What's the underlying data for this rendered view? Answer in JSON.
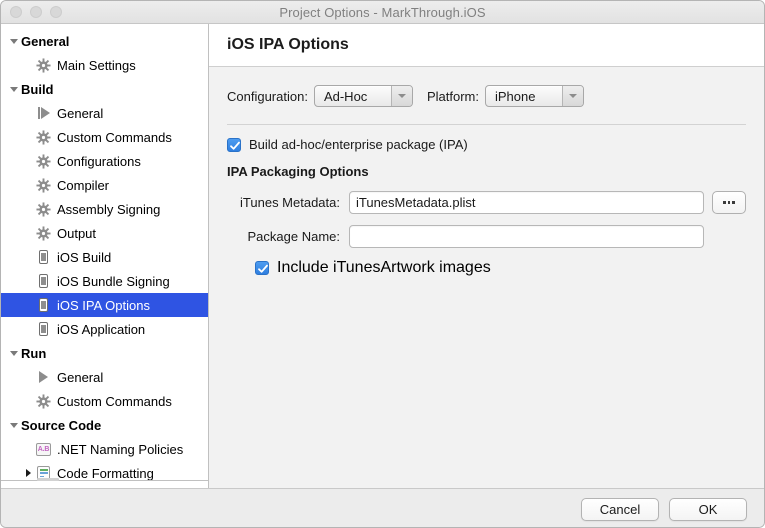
{
  "window": {
    "title": "Project Options - MarkThrough.iOS",
    "traffic_lights": [
      "close-button",
      "minimize-button",
      "zoom-button"
    ]
  },
  "sidebar": {
    "items": [
      {
        "label": "General",
        "level": 0,
        "type": "group",
        "disclosure": "down",
        "icon": "none",
        "selected": false
      },
      {
        "label": "Main Settings",
        "level": 1,
        "type": "item",
        "disclosure": "none",
        "icon": "gear-icon",
        "selected": false
      },
      {
        "label": "Build",
        "level": 0,
        "type": "group",
        "disclosure": "down",
        "icon": "none",
        "selected": false
      },
      {
        "label": "General",
        "level": 1,
        "type": "item",
        "disclosure": "none",
        "icon": "build-icon",
        "selected": false
      },
      {
        "label": "Custom Commands",
        "level": 1,
        "type": "item",
        "disclosure": "none",
        "icon": "gear-icon",
        "selected": false
      },
      {
        "label": "Configurations",
        "level": 1,
        "type": "item",
        "disclosure": "none",
        "icon": "gear-icon",
        "selected": false
      },
      {
        "label": "Compiler",
        "level": 1,
        "type": "item",
        "disclosure": "none",
        "icon": "gear-icon",
        "selected": false
      },
      {
        "label": "Assembly Signing",
        "level": 1,
        "type": "item",
        "disclosure": "none",
        "icon": "gear-icon",
        "selected": false
      },
      {
        "label": "Output",
        "level": 1,
        "type": "item",
        "disclosure": "none",
        "icon": "gear-icon",
        "selected": false
      },
      {
        "label": "iOS Build",
        "level": 1,
        "type": "item",
        "disclosure": "none",
        "icon": "device-icon",
        "selected": false
      },
      {
        "label": "iOS Bundle Signing",
        "level": 1,
        "type": "item",
        "disclosure": "none",
        "icon": "device-icon",
        "selected": false
      },
      {
        "label": "iOS IPA Options",
        "level": 1,
        "type": "item",
        "disclosure": "none",
        "icon": "device-icon",
        "selected": true
      },
      {
        "label": "iOS Application",
        "level": 1,
        "type": "item",
        "disclosure": "none",
        "icon": "device-icon",
        "selected": false
      },
      {
        "label": "Run",
        "level": 0,
        "type": "group",
        "disclosure": "down",
        "icon": "none",
        "selected": false
      },
      {
        "label": "General",
        "level": 1,
        "type": "item",
        "disclosure": "none",
        "icon": "play-icon",
        "selected": false
      },
      {
        "label": "Custom Commands",
        "level": 1,
        "type": "item",
        "disclosure": "none",
        "icon": "gear-icon",
        "selected": false
      },
      {
        "label": "Source Code",
        "level": 0,
        "type": "group",
        "disclosure": "down",
        "icon": "none",
        "selected": false
      },
      {
        "label": ".NET Naming Policies",
        "level": 1,
        "type": "item",
        "disclosure": "none",
        "icon": "ab-icon",
        "selected": false
      },
      {
        "label": "Code Formatting",
        "level": 1,
        "type": "item",
        "disclosure": "right",
        "icon": "document-icon",
        "selected": false
      }
    ],
    "selection_color": "#2f54e3",
    "ab_icon_text": "A.B"
  },
  "content": {
    "title": "iOS IPA Options",
    "configuration_label": "Configuration:",
    "configuration_value": "Ad-Hoc",
    "platform_label": "Platform:",
    "platform_value": "iPhone",
    "build_package_checkbox": {
      "label": "Build ad-hoc/enterprise package (IPA)",
      "checked": true
    },
    "section_title": "IPA Packaging Options",
    "fields": [
      {
        "label": "iTunes Metadata:",
        "value": "iTunesMetadata.plist",
        "placeholder": "",
        "has_browse": true
      },
      {
        "label": "Package Name:",
        "value": "",
        "placeholder": "",
        "has_browse": false
      }
    ],
    "browse_button_label": "...",
    "artwork_checkbox": {
      "label": "Include iTunesArtwork images",
      "checked": true
    },
    "checkbox_color": "#3b8bef"
  },
  "footer": {
    "cancel_label": "Cancel",
    "ok_label": "OK"
  }
}
